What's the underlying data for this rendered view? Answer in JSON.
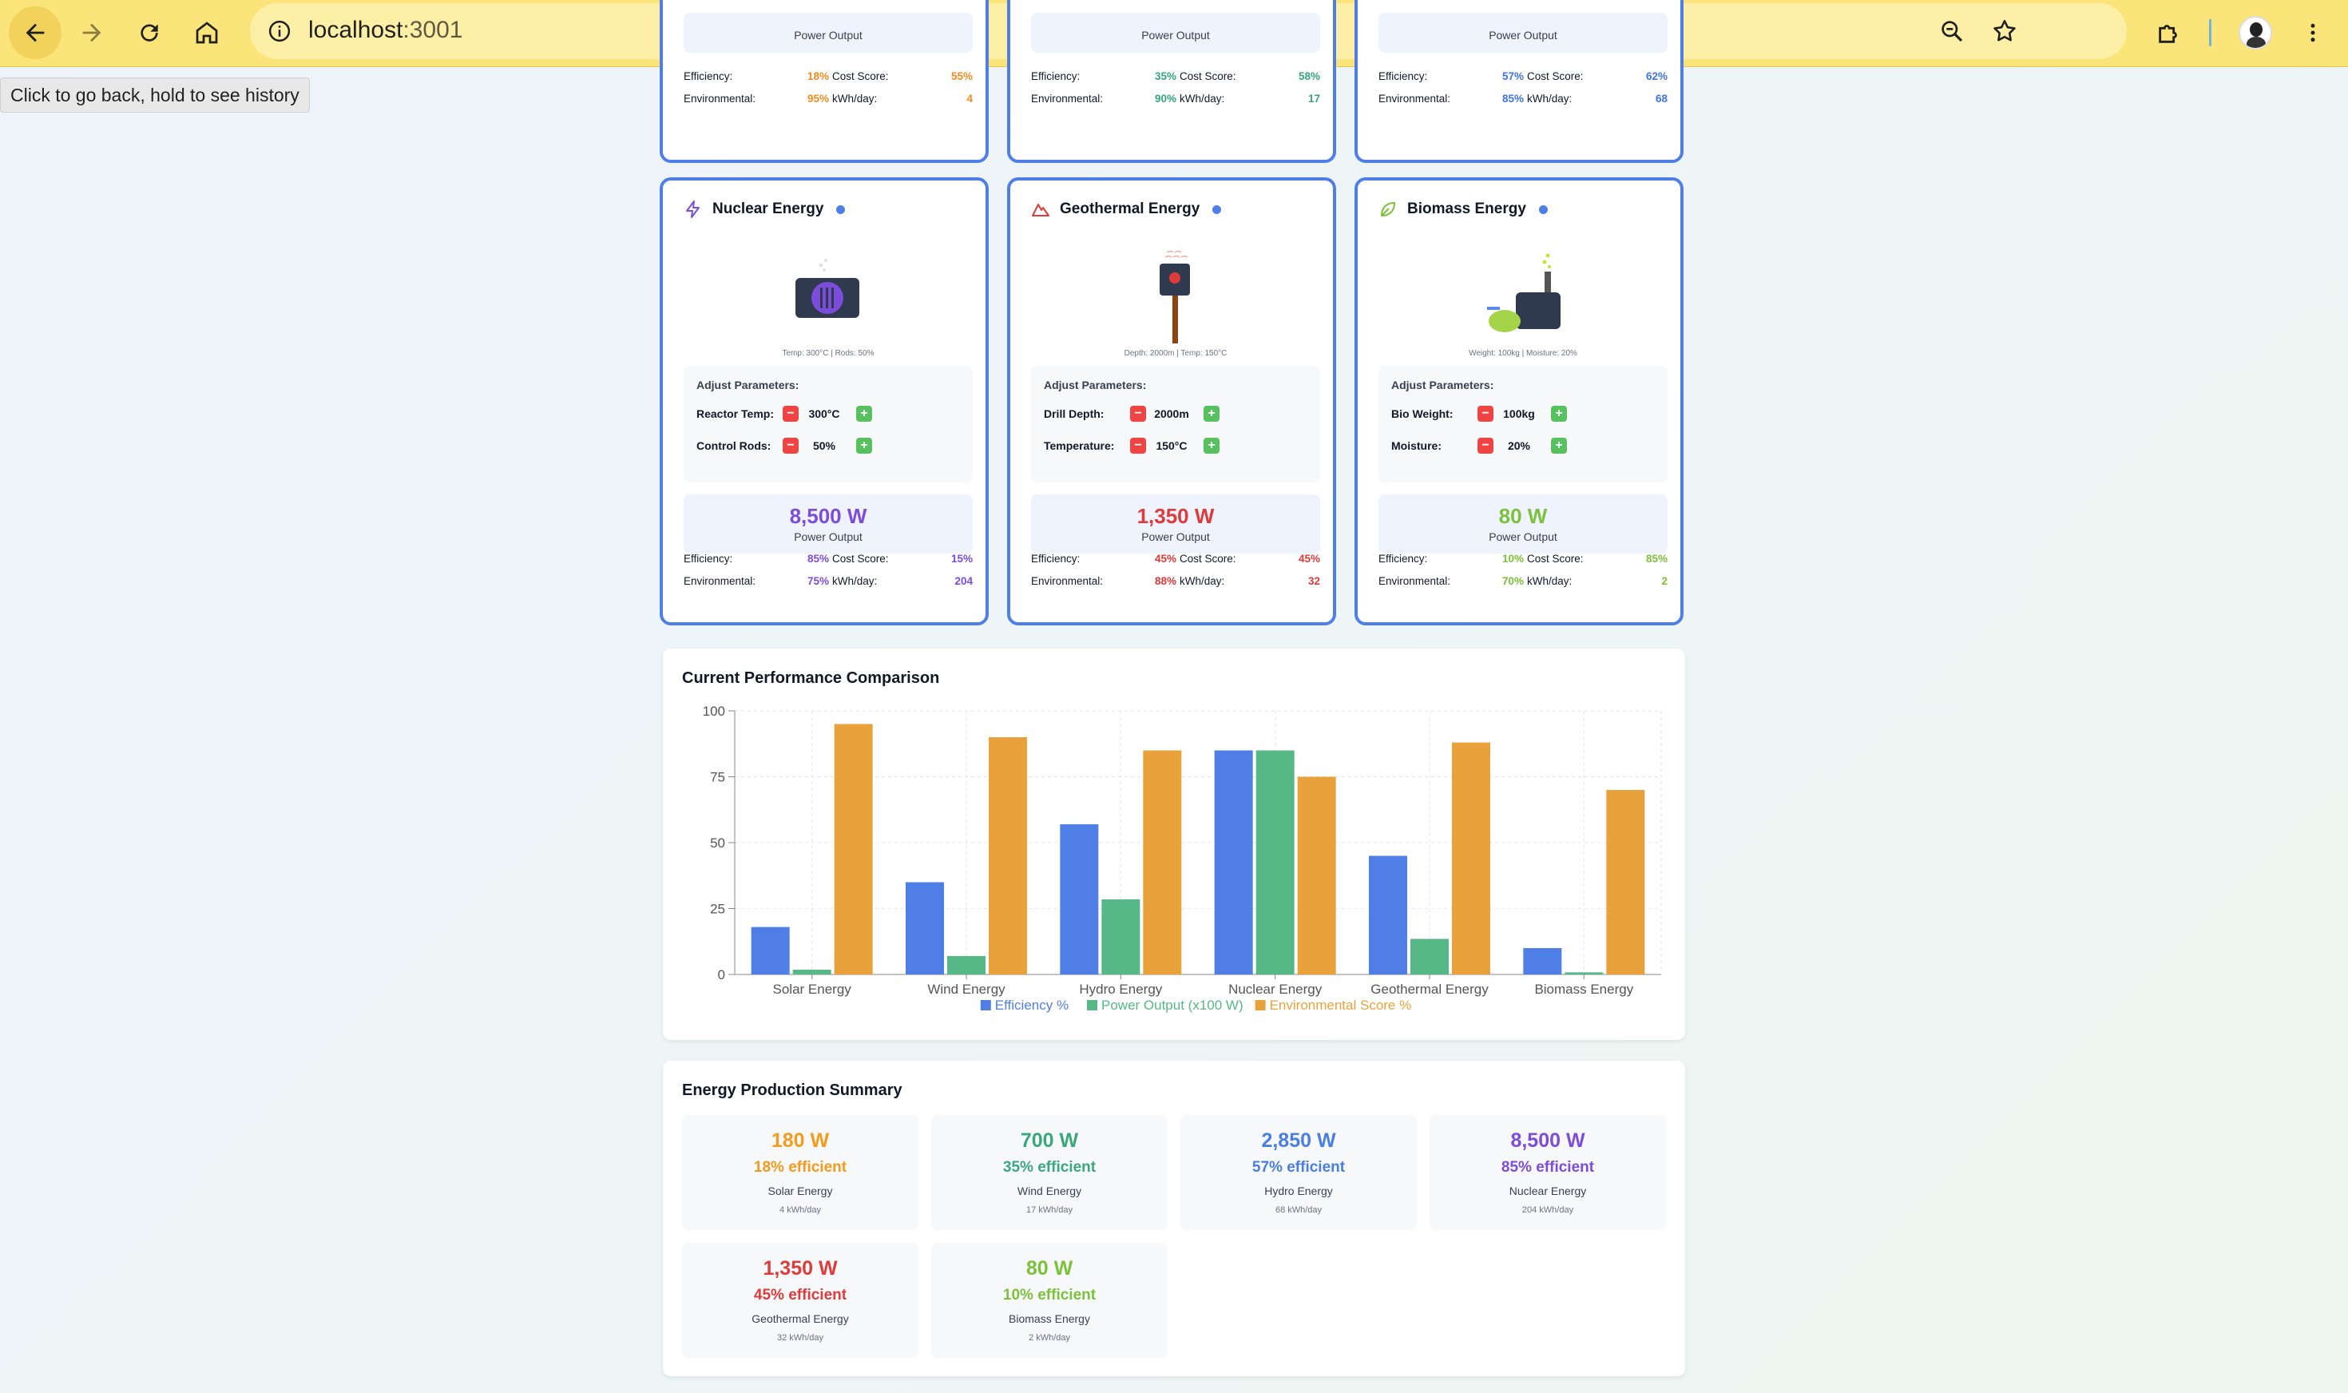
{
  "browser": {
    "url_host": "localhost",
    "url_port": ":3001",
    "tooltip": "Click to go back, hold to see history"
  },
  "colors": {
    "efficiency": "#4f7fe6",
    "power": "#56b886",
    "environmental": "#e9a23b",
    "card_border": "#4f7fe6"
  },
  "top_cards": [
    {
      "power_label": "Power Output",
      "efficiency_label": "Efficiency:",
      "efficiency": "18%",
      "cost_label": "Cost Score:",
      "cost": "55%",
      "env_label": "Environmental:",
      "environmental": "95%",
      "kwh_label": "kWh/day:",
      "kwh": "4",
      "color": "#f28c1e"
    },
    {
      "power_label": "Power Output",
      "efficiency_label": "Efficiency:",
      "efficiency": "35%",
      "cost_label": "Cost Score:",
      "cost": "58%",
      "env_label": "Environmental:",
      "environmental": "90%",
      "kwh_label": "kWh/day:",
      "kwh": "17",
      "color": "#35a77a"
    },
    {
      "power_label": "Power Output",
      "efficiency_label": "Efficiency:",
      "efficiency": "57%",
      "cost_label": "Cost Score:",
      "cost": "62%",
      "env_label": "Environmental:",
      "environmental": "85%",
      "kwh_label": "kWh/day:",
      "kwh": "68",
      "color": "#3f74e0"
    }
  ],
  "cards": [
    {
      "title": "Nuclear Energy",
      "icon": "lightning-icon",
      "color": "#7c4ddb",
      "viz_caption": "Temp: 300°C | Rods: 50%",
      "params_title": "Adjust Parameters:",
      "params": [
        {
          "label": "Reactor Temp:",
          "value": "300°C"
        },
        {
          "label": "Control Rods:",
          "value": "50%"
        }
      ],
      "power": "8,500 W",
      "power_label": "Power Output",
      "efficiency_label": "Efficiency:",
      "efficiency": "85%",
      "cost_label": "Cost Score:",
      "cost": "15%",
      "env_label": "Environmental:",
      "environmental": "75%",
      "kwh_label": "kWh/day:",
      "kwh": "204"
    },
    {
      "title": "Geothermal Energy",
      "icon": "mountain-icon",
      "color": "#de3b3b",
      "viz_caption": "Depth: 2000m | Temp: 150°C",
      "params_title": "Adjust Parameters:",
      "params": [
        {
          "label": "Drill Depth:",
          "value": "2000m"
        },
        {
          "label": "Temperature:",
          "value": "150°C"
        }
      ],
      "power": "1,350 W",
      "power_label": "Power Output",
      "efficiency_label": "Efficiency:",
      "efficiency": "45%",
      "cost_label": "Cost Score:",
      "cost": "45%",
      "env_label": "Environmental:",
      "environmental": "88%",
      "kwh_label": "kWh/day:",
      "kwh": "32"
    },
    {
      "title": "Biomass Energy",
      "icon": "leaf-icon",
      "color": "#7cc13a",
      "viz_caption": "Weight: 100kg | Moisture: 20%",
      "params_title": "Adjust Parameters:",
      "params": [
        {
          "label": "Bio Weight:",
          "value": "100kg"
        },
        {
          "label": "Moisture:",
          "value": "20%"
        }
      ],
      "power": "80 W",
      "power_label": "Power Output",
      "efficiency_label": "Efficiency:",
      "efficiency": "10%",
      "cost_label": "Cost Score:",
      "cost": "85%",
      "env_label": "Environmental:",
      "environmental": "70%",
      "kwh_label": "kWh/day:",
      "kwh": "2"
    }
  ],
  "chart": {
    "title": "Current Performance Comparison"
  },
  "chart_data": {
    "type": "bar",
    "categories": [
      "Solar Energy",
      "Wind Energy",
      "Hydro Energy",
      "Nuclear Energy",
      "Geothermal Energy",
      "Biomass Energy"
    ],
    "series": [
      {
        "name": "Efficiency %",
        "values": [
          18,
          35,
          57,
          85,
          45,
          10
        ]
      },
      {
        "name": "Power Output (x100 W)",
        "values": [
          1.8,
          7,
          28.5,
          85,
          13.5,
          0.8
        ]
      },
      {
        "name": "Environmental Score %",
        "values": [
          95,
          90,
          85,
          75,
          88,
          70
        ]
      }
    ],
    "ylim": [
      0,
      100
    ],
    "yticks": [
      "0",
      "25",
      "50",
      "75",
      "100"
    ],
    "grid": true,
    "legend": "bottom"
  },
  "summary": {
    "title": "Energy Production Summary",
    "items": [
      {
        "power": "180 W",
        "efficiency": "18% efficient",
        "name": "Solar Energy",
        "kwh": "4 kWh/day",
        "color": "#f29b1e"
      },
      {
        "power": "700 W",
        "efficiency": "35% efficient",
        "name": "Wind Energy",
        "kwh": "17 kWh/day",
        "color": "#3aa87c"
      },
      {
        "power": "2,850 W",
        "efficiency": "57% efficient",
        "name": "Hydro Energy",
        "kwh": "68 kWh/day",
        "color": "#4a7ee3"
      },
      {
        "power": "8,500 W",
        "efficiency": "85% efficient",
        "name": "Nuclear Energy",
        "kwh": "204 kWh/day",
        "color": "#7c4ddb"
      },
      {
        "power": "1,350 W",
        "efficiency": "45% efficient",
        "name": "Geothermal Energy",
        "kwh": "32 kWh/day",
        "color": "#de3b3b"
      },
      {
        "power": "80 W",
        "efficiency": "10% efficient",
        "name": "Biomass Energy",
        "kwh": "2 kWh/day",
        "color": "#7cc13a"
      }
    ]
  }
}
